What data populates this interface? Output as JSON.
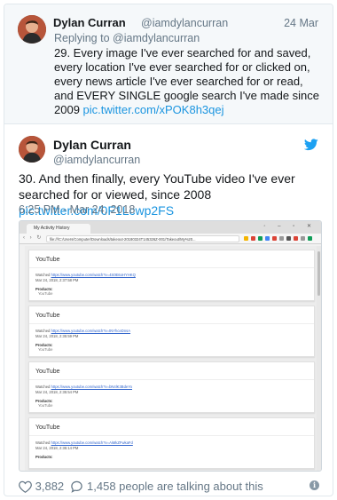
{
  "reply_tweet": {
    "name": "Dylan Curran",
    "handle": "@iamdylancurran",
    "date": "24 Mar",
    "replying_label": "Replying to",
    "replying_handle": "@iamdylancurran",
    "text": "29. Every image I've ever searched for and saved, every location I've ever searched for or clicked on, every news article I've ever searched for or read, and EVERY SINGLE google search I've made since 2009",
    "link": "pic.twitter.com/xPOK8h3qej"
  },
  "main_tweet": {
    "name": "Dylan Curran",
    "handle": "@iamdylancurran",
    "text": "30. And then finally, every YouTube video I've ever searched for or viewed, since 2008",
    "link": "pic.twitter.com/0F1Lcwp2FS",
    "timestamp": "6:25 PM - Mar 24, 2018"
  },
  "screenshot": {
    "tab_title": "My Activity History",
    "address": "file:///C:/Users/Computer/Downloads/takeout-20180324T145326Z-001/Takeout/My%20...",
    "cards": [
      {
        "title": "YouTube",
        "watched": "Watched",
        "url": "https://www.youtube.com/watch?v=4S0E6oHYHKQ",
        "date": "Mar 24, 2018, 2:37:58 PM",
        "products": "Products:",
        "product": "YouTube"
      },
      {
        "title": "YouTube",
        "watched": "Watched",
        "url": "https://www.youtube.com/watch?v=tNYhceDnsA",
        "date": "Mar 24, 2018, 2:35:59 PM",
        "products": "Products:",
        "product": "YouTube"
      },
      {
        "title": "YouTube",
        "watched": "Watched",
        "url": "https://www.youtube.com/watch?v=bN4lK3BdeYo",
        "date": "Mar 24, 2018, 2:35:54 PM",
        "products": "Products:",
        "product": "YouTube"
      },
      {
        "title": "YouTube",
        "watched": "Watched",
        "url": "https://www.youtube.com/watch?v=AiMkZFwkaFd",
        "date": "Mar 24, 2018, 2:35:14 PM",
        "products": "Products:",
        "product": ""
      }
    ]
  },
  "footer": {
    "likes": "3,882",
    "talking": "1,458 people are talking about this"
  },
  "icons": {
    "bird": "twitter-bird-icon",
    "heart": "heart-icon",
    "comment": "comment-bubble-icon",
    "info": "info-icon"
  },
  "colors": {
    "link": "#1b95e0",
    "twitter_blue": "#1da1f2",
    "muted": "#657786",
    "reply_bg": "#f5f8fa"
  }
}
